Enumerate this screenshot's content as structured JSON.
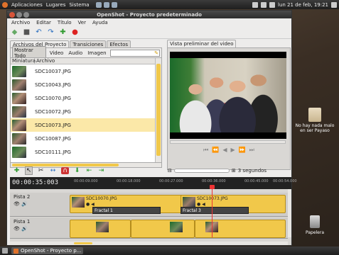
{
  "top_panel": {
    "menus": [
      "Aplicaciones",
      "Lugares",
      "Sistema"
    ],
    "clock": "lun 21 de feb, 19:21"
  },
  "window": {
    "title": "OpenShot - Proyecto predeterminado",
    "menu": [
      "Archivo",
      "Editar",
      "Título",
      "Ver",
      "Ayuda"
    ],
    "toolbar_icons": [
      "new-project-icon",
      "save-icon",
      "undo-icon",
      "redo-icon",
      "add-files-icon",
      "record-icon"
    ]
  },
  "project_panel": {
    "tabs": [
      "Archivos del Proyecto",
      "Transiciones",
      "Efectos"
    ],
    "filters": [
      "Mostrar Todo",
      "Video",
      "Audio",
      "Imagen"
    ],
    "search_value": "",
    "columns": [
      "Miniatura",
      "Archivo"
    ],
    "files": [
      {
        "name": "SDC10037.JPG",
        "thumb": "t0"
      },
      {
        "name": "SDC10043.JPG",
        "thumb": "t1"
      },
      {
        "name": "SDC10070.JPG",
        "thumb": "t2"
      },
      {
        "name": "SDC10072.JPG",
        "thumb": "t3"
      },
      {
        "name": "SDC10073.JPG",
        "thumb": "t2",
        "selected": true
      },
      {
        "name": "SDC10087.JPG",
        "thumb": "t1"
      },
      {
        "name": "SDC10111.JPG",
        "thumb": "t0"
      }
    ]
  },
  "preview": {
    "tab": "Vista preliminar del video",
    "controls": [
      "⏮",
      "⏪",
      "◀",
      "▶",
      "⏩",
      "⏭"
    ]
  },
  "timeline_toolbar": {
    "zoom_label": "3 segundos"
  },
  "timeline": {
    "timecode": "00:00:35:003",
    "ticks": [
      "00:00:09.000",
      "00:00:18.000",
      "00:00:27.000",
      "00:00:36.000",
      "00:00:45.000",
      "00:00:54.000"
    ],
    "tracks": [
      {
        "name": "Pista 2",
        "clips": [
          {
            "name": "SDC10070.JPG"
          },
          {
            "name": "SDC10073.JPG"
          }
        ],
        "transitions": [
          "Fractal 1",
          "Fractal 3"
        ]
      },
      {
        "name": "Pista 1",
        "clips": [
          {
            "name": ""
          },
          {
            "name": ""
          },
          {
            "name": ""
          }
        ]
      }
    ]
  },
  "desktop": {
    "icons": [
      {
        "label": "No hay nada malo en ser Payaso"
      },
      {
        "label": "Papelera"
      }
    ]
  },
  "taskbar": {
    "task": "OpenShot - Proyecto p..."
  }
}
